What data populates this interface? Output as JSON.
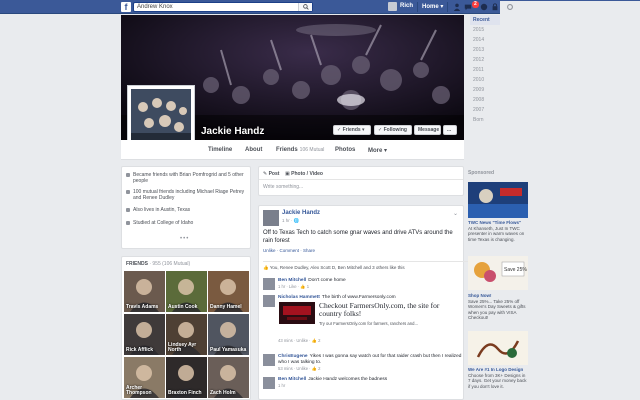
{
  "topbar": {
    "logo": "f",
    "search_value": "Andrew Knox",
    "user_name": "Rich",
    "home_label": "Home",
    "notif_badge": "2"
  },
  "profile": {
    "name": "Jackie Handz",
    "friends_btn": "Friends",
    "following_btn": "Following",
    "message_btn": "Message",
    "more_btn": "..."
  },
  "tabs": [
    {
      "label": "Timeline"
    },
    {
      "label": "About"
    },
    {
      "label": "Friends",
      "count": "106 Mutual"
    },
    {
      "label": "Photos"
    },
    {
      "label": "More"
    }
  ],
  "years": [
    "Recent",
    "2015",
    "2014",
    "2013",
    "2012",
    "2011",
    "2010",
    "2009",
    "2008",
    "2007",
    "Born"
  ],
  "about": {
    "items": [
      "Became friends with Brian Pomfrogrid and 5 other people",
      "100 mutual friends including Michael Riage Petrey and Renee Dudley",
      "Also lives in Austin, Texas",
      "Studied at College of Idaho"
    ],
    "more": "•••"
  },
  "friends": {
    "header": "FRIENDS",
    "count": "· 955 (106 Mutual)",
    "tiles": [
      {
        "name": "Travis Adams",
        "color": "#6b5a4e"
      },
      {
        "name": "Austin Cook",
        "color": "#5b6b3a"
      },
      {
        "name": "Danny Hamel",
        "color": "#7a5a40"
      },
      {
        "name": "Rick Afflick",
        "color": "#3f3a3a"
      },
      {
        "name": "Lindsey Ayr North",
        "color": "#4e4034"
      },
      {
        "name": "Paul Yamasuka",
        "color": "#505560"
      },
      {
        "name": "Archer Thompson",
        "color": "#8a7a66"
      },
      {
        "name": "Braxton Finch",
        "color": "#2e2a2a"
      },
      {
        "name": "Zach Holm",
        "color": "#6a5e58"
      }
    ]
  },
  "composer": {
    "tab_post": "Post",
    "tab_photo": "Photo / Video",
    "placeholder": "Write something..."
  },
  "post": {
    "author": "Jackie Handz",
    "meta": "1 hr · 🌐",
    "text": "Off to Texas Tech to catch some gnar waves and drive ATVs around the rain forest",
    "actions": "Unlike · Comment · Share",
    "likes": "You, Renee Dudley, Alex Scott D, Ben Mitchell and 3 others like this",
    "comments": [
      {
        "author": "Ben Mitchell",
        "text": "Don't come home",
        "meta": "1 hr · Like · 👍 1"
      },
      {
        "author": "Nicholas Hammett",
        "text": "The birth of www.Farmersonly.com",
        "meta": "43 mins · Unlike · 👍 2"
      },
      {
        "author": "ChrisEugene",
        "text": "Yikes I was gonna say watch out for that raider crash but then I realized who I was talking to.",
        "meta": "53 mins · Unlike · 👍 2"
      },
      {
        "author": "Ben Mitchell",
        "text": "Jackie Handz welcomes the badness",
        "meta": "1 hr"
      }
    ],
    "ad": {
      "headline": "Checkout FarmersOnly.com, the site for country folks!",
      "small": "Try our FarmersOnly.com for farmers, ranchers and…",
      "url": "farmersonly.com"
    }
  },
  "sponsored": {
    "header": "Sponsored",
    "ads": [
      {
        "title": "TWC News \"Time Flows\"",
        "text": "At Khanseth, Just In TWC presenter in warm waves on time Texas is changing."
      },
      {
        "title": "Shop Now!",
        "text": "Save 25%... Take 25% off Women's Day Sweets & gifts when you pay with VISA Checkout!"
      },
      {
        "title": "We Are #1 In Logo Design",
        "text": "Choose from 3K+ Designs in 7 days. Get your money back if you don't love it."
      }
    ]
  },
  "colors": {
    "brand": "#3b5998",
    "link": "#365899",
    "background": "#e9ebee"
  }
}
